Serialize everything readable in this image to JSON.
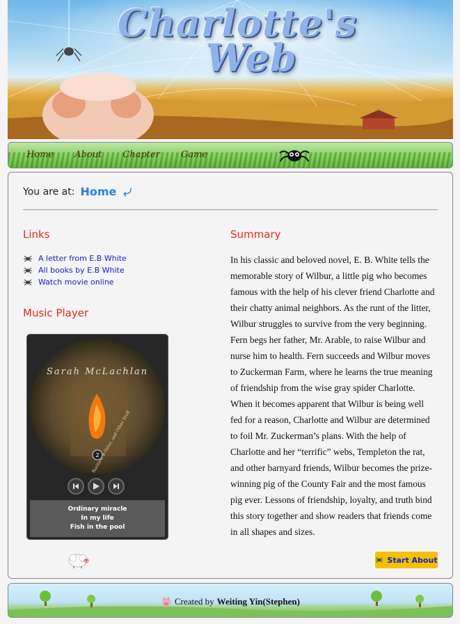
{
  "banner": {
    "title_line1": "Charlotte's",
    "title_line2": "Web"
  },
  "nav": {
    "items": [
      {
        "label": "Home"
      },
      {
        "label": "About"
      },
      {
        "label": "Chapter"
      },
      {
        "label": "Game"
      }
    ]
  },
  "breadcrumb": {
    "prefix": "You are at:",
    "current": "Home"
  },
  "links": {
    "heading": "Links",
    "items": [
      {
        "label": "A letter from E.B White"
      },
      {
        "label": "All books by E.B White"
      },
      {
        "label": "Watch movie online"
      }
    ]
  },
  "music_player": {
    "heading": "Music Player",
    "album_artist": "Sarah McLachlan",
    "album_subtitle": "Rarities, B-Sides, and Other Stuff",
    "album_number": "2",
    "playlist": [
      "Ordinary miracle",
      "In my life",
      "Fish in the pool"
    ]
  },
  "summary": {
    "heading": "Summary",
    "text": "In his classic and beloved novel, E. B. White tells the memorable story of Wilbur, a little pig who becomes famous with the help of his clever friend Charlotte and their chatty animal neighbors. As the runt of the litter, Wilbur struggles to survive from the very beginning. Fern begs her father, Mr. Arable, to raise Wilbur and nurse him to health. Fern succeeds and Wilbur moves to Zuckerman Farm, where he learns the true meaning of friendship from the wise gray spider Charlotte. When it becomes apparent that Wilbur is being well fed for a reason, Charlotte and Wilbur are determined to foil Mr. Zuckerman’s plans. With the help of Charlotte and her “terrific” webs, Templeton the rat, and other barnyard friends, Wilbur becomes the prize-winning pig of the County Fair and the most famous pig ever. Lessons of friendship, loyalty, and truth bind this story together and show readers that friends come in all shapes and sizes."
  },
  "start_button": {
    "label": "Start About"
  },
  "footer": {
    "prefix": "Created by",
    "author": "Weiting Yin(Stephen)"
  },
  "colors": {
    "accent_red": "#e62a1e",
    "link_blue": "#1a1acc",
    "home_blue": "#2f7fdc",
    "button_yellow": "#f2c200"
  }
}
